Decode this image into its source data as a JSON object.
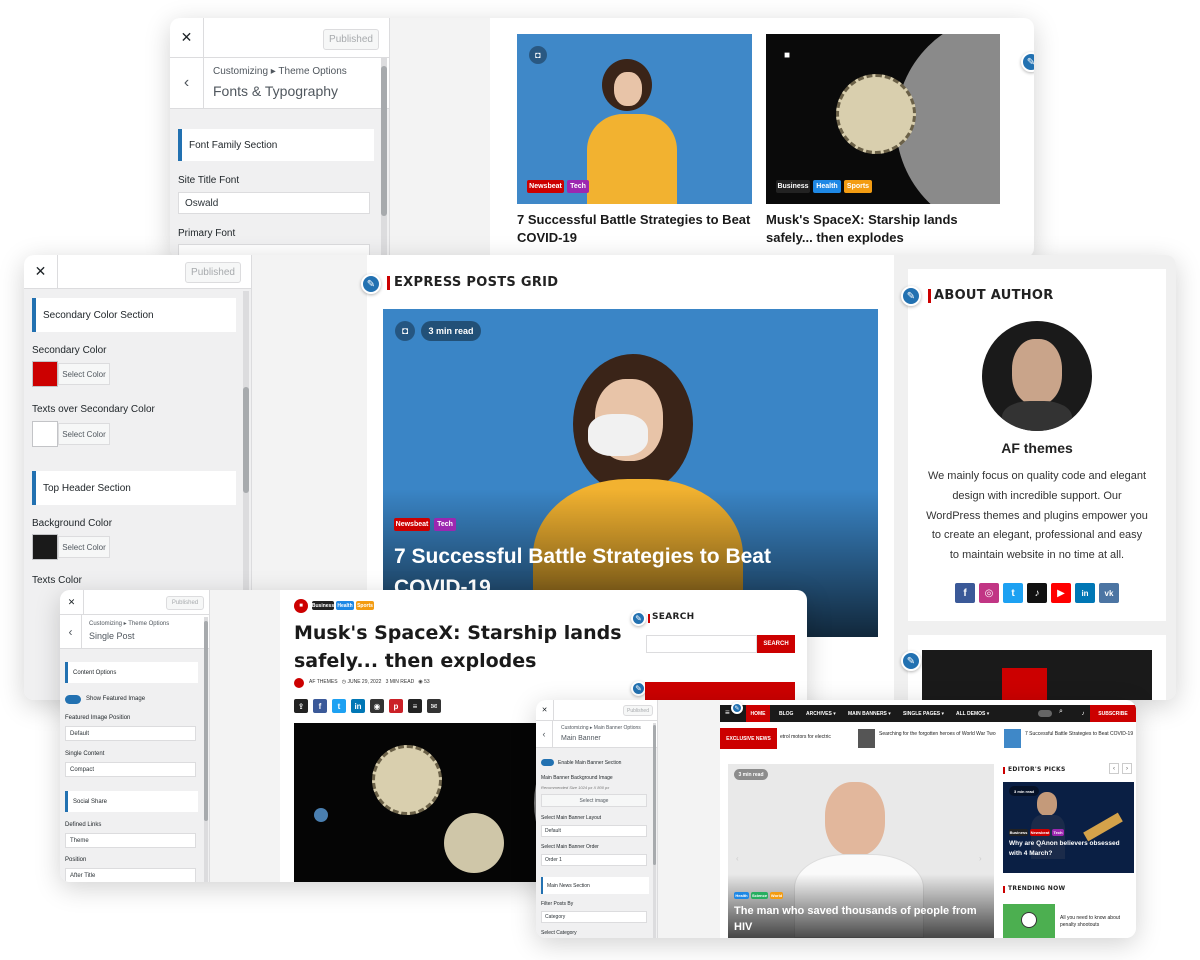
{
  "win1": {
    "published": "Published",
    "crumb": "Customizing ▸ Theme Options",
    "title": "Fonts & Typography",
    "section": "Font Family Section",
    "label_site_title_font": "Site Title Font",
    "site_title_font_value": "Oswald",
    "label_primary_font": "Primary Font",
    "card1_title": "7 Successful Battle Strategies to Beat COVID-19",
    "card1_tags": [
      "Newsbeat",
      "Tech"
    ],
    "card2_title": "Musk's SpaceX: Starship lands safely... then explodes",
    "card2_tags": [
      "Business",
      "Health",
      "Sports"
    ]
  },
  "win2": {
    "published": "Published",
    "sec_secondary": "Secondary Color Section",
    "label_secondary": "Secondary Color",
    "select_color": "Select Color",
    "label_texts_secondary": "Texts over Secondary Color",
    "sec_top_header": "Top Header Section",
    "label_bg": "Background Color",
    "label_texts": "Texts Color",
    "express_title": "EXPRESS POSTS GRID",
    "read_time": "3 min read",
    "tags": [
      "Newsbeat",
      "Tech"
    ],
    "big_headline": "7 Successful Battle Strategies to Beat COVID-19",
    "about_title": "ABOUT AUTHOR",
    "author_name": "AF themes",
    "author_bio": "We mainly focus on quality code and elegant design with incredible support. Our WordPress themes and plugins empower you to create an elegant, professional and easy to maintain website in no time at all.",
    "socials": [
      "f",
      "◎",
      "t",
      "♪",
      "▶",
      "in",
      "vk"
    ]
  },
  "win3": {
    "published": "Published",
    "crumb": "Customizing ▸ Theme Options",
    "title": "Single Post",
    "sec_content": "Content Options",
    "toggle_label": "Show Featured Image",
    "label_position": "Featured Image Position",
    "val_position": "Default",
    "label_single_content": "Single Content",
    "val_single_content": "Compact",
    "sec_social": "Social Share",
    "label_defined_links": "Defined Links",
    "val_defined_links": "Theme",
    "label_pos": "Position",
    "val_pos": "After Title",
    "tags": [
      "Business",
      "Health",
      "Sports"
    ],
    "post_title": "Musk's SpaceX: Starship lands safely... then explodes",
    "meta_author": "AF THEMES",
    "meta_date": "JUNE 29, 2022",
    "meta_read": "3 MIN READ",
    "meta_views": "53",
    "search_title": "SEARCH",
    "search_btn": "SEARCH"
  },
  "win4": {
    "published": "Published",
    "crumb": "Customizing ▸ Main Banner Options",
    "title": "Main Banner",
    "toggle_label": "Enable Main Banner Section",
    "label_bg_image": "Main Banner Background Image",
    "recommend": "Recommended Size 1024 px X 800 px",
    "select_image": "Select image",
    "label_layout": "Select Main Banner Layout",
    "val_layout": "Default",
    "label_order": "Select Main Banner Order",
    "val_order": "Order 1",
    "sec_news": "Main News Section",
    "label_filter": "Filter Posts By",
    "val_filter": "Category",
    "label_select_cat": "Select Category",
    "nav": [
      "HOME",
      "BLOG",
      "ARCHIVES ▾",
      "MAIN BANNERS ▾",
      "SINGLE PAGES ▾",
      "ALL DEMOS ▾"
    ],
    "subscribe": "SUBSCRIBE",
    "exclusive": "EXCLUSIVE NEWS",
    "ticker": [
      "etrol motors for electric",
      "Searching for the forgotten heroes of World War Two",
      "7 Successful Battle Strategies to Beat COVID-19"
    ],
    "read_time": "3 min read",
    "tags": [
      "Health",
      "Science",
      "World"
    ],
    "banner_headline": "The man who saved thousands of people from HIV",
    "editors_picks": "EDITOR'S PICKS",
    "pick_read": "3 min read",
    "pick_tags": [
      "Business",
      "Newsbeat",
      "Tech"
    ],
    "pick_title": "Why are QAnon believers obsessed with 4 March?",
    "trending": "TRENDING NOW",
    "trend_title": "All you need to know about penalty shootouts",
    "trend_date": "JUNE 29, 2022"
  },
  "colors": {
    "accent": "#2271b1",
    "red": "#cc0000",
    "newsbeat": "#cc0000",
    "tech": "#9c27b0",
    "business": "#222222",
    "health": "#1e88e5",
    "sports": "#f39c12"
  }
}
